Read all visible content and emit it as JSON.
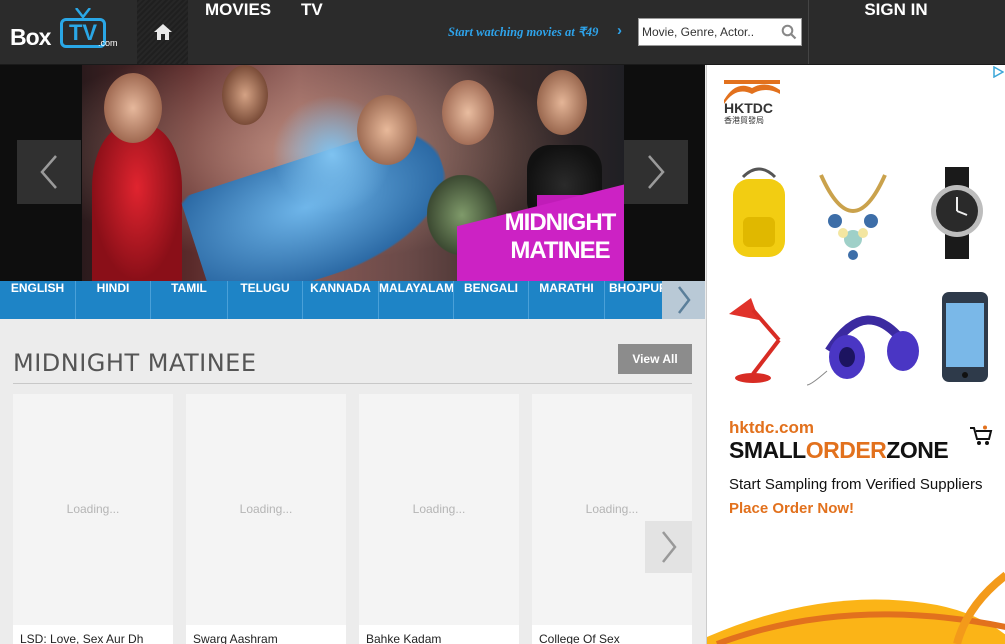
{
  "header": {
    "logo_box": "Box",
    "logo_tv": "TV",
    "logo_com": ".com",
    "nav": [
      "MOVIES",
      "TV"
    ],
    "promo": "Start watching movies at ₹49",
    "search_placeholder": "Movie, Genre, Actor..",
    "sign_in": "SIGN IN"
  },
  "hero": {
    "title_line1": "MIDNIGHT",
    "title_line2": "MATINEE"
  },
  "languages": [
    "ENGLISH",
    "HINDI",
    "TAMIL",
    "TELUGU",
    "KANNADA",
    "MALAYALAM",
    "BENGALI",
    "MARATHI",
    "BHOJPURI"
  ],
  "section": {
    "title": "MIDNIGHT MATINEE",
    "view_all": "View All",
    "cards": [
      {
        "loading": "Loading...",
        "title": "LSD: Love, Sex Aur Dh"
      },
      {
        "loading": "Loading...",
        "title": "Swarg Aashram"
      },
      {
        "loading": "Loading...",
        "title": "Bahke Kadam"
      },
      {
        "loading": "Loading...",
        "title": "College Of Sex"
      }
    ]
  },
  "ad": {
    "logo_text": "HKTDC",
    "logo_sub": "香港貿發局",
    "brand": "hktdc.com",
    "zone_1": "SMALL",
    "zone_2": "ORDER",
    "zone_3": "ZONE",
    "tagline": "Start Sampling from Verified Suppliers",
    "cta": "Place Order Now!"
  },
  "colors": {
    "accent_blue": "#1e84c6",
    "promo_blue": "#2ea3ea",
    "ad_orange": "#e2711d",
    "title_magenta": "#c01cb8"
  }
}
